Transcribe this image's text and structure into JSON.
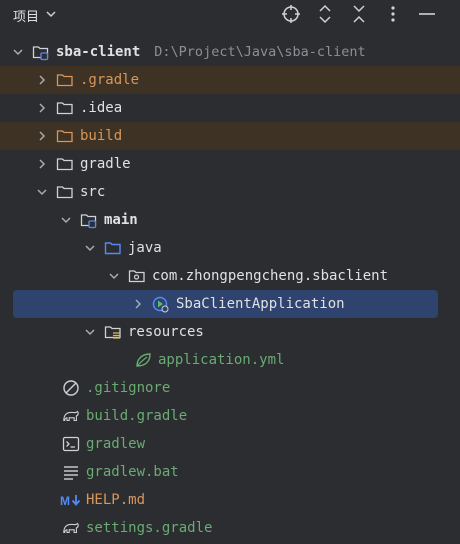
{
  "header": {
    "title": "项目"
  },
  "tree": {
    "root": {
      "label": "sba-client",
      "path": "D:\\Project\\Java\\sba-client"
    },
    "gradle_dir": {
      "label": ".gradle"
    },
    "idea_dir": {
      "label": ".idea"
    },
    "build_dir": {
      "label": "build"
    },
    "gradle_folder": {
      "label": "gradle"
    },
    "src": {
      "label": "src"
    },
    "main": {
      "label": "main"
    },
    "java": {
      "label": "java"
    },
    "package": {
      "label": "com.zhongpengcheng.sbaclient"
    },
    "app_class": {
      "label": "SbaClientApplication"
    },
    "resources": {
      "label": "resources"
    },
    "app_yml": {
      "label": "application.yml"
    },
    "gitignore": {
      "label": ".gitignore"
    },
    "build_gradle": {
      "label": "build.gradle"
    },
    "gradlew": {
      "label": "gradlew"
    },
    "gradlew_bat": {
      "label": "gradlew.bat"
    },
    "help_md": {
      "label": "HELP.md"
    },
    "settings_gradle": {
      "label": "settings.gradle"
    }
  },
  "colors": {
    "background": "#2b2d30",
    "selection": "#2e436e",
    "excluded_highlight": "#3d3223",
    "excluded_text": "#d9975b",
    "new_file_text": "#6aab73",
    "folder_blue": "#548af7"
  }
}
